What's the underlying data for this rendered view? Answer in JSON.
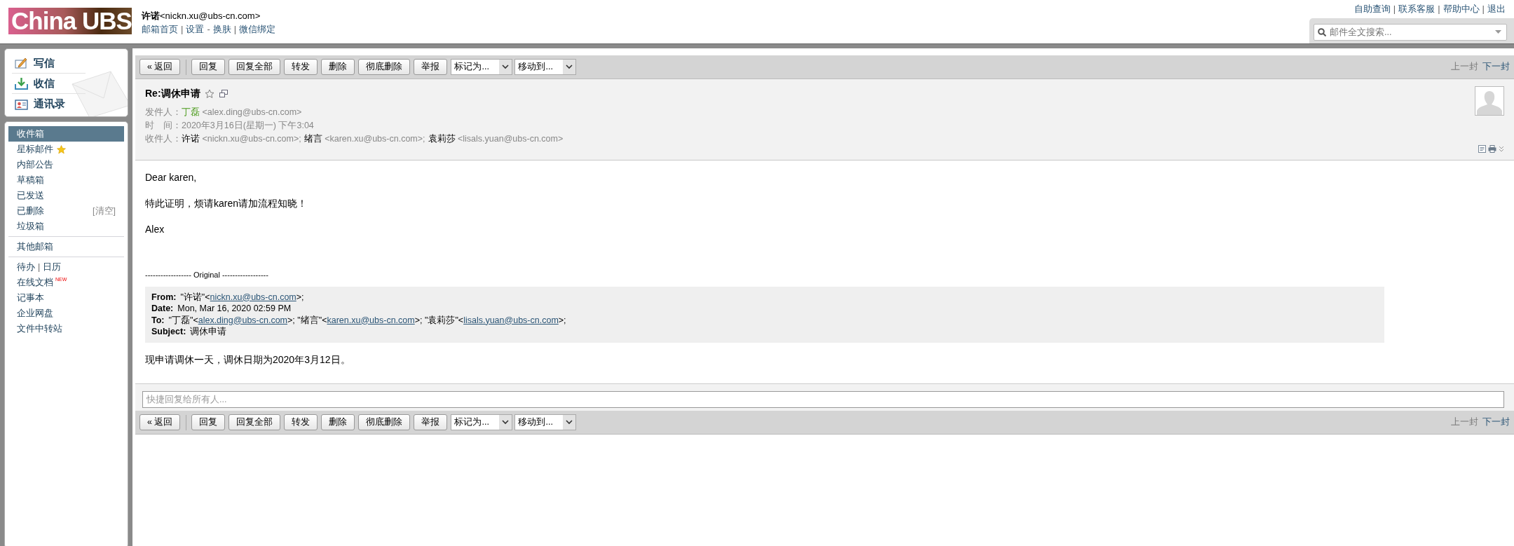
{
  "header": {
    "logo": "China UBS",
    "user_name": "许诺",
    "user_email": "<nickn.xu@ubs-cn.com>",
    "links": [
      {
        "kind": "link",
        "text": "邮箱首页"
      },
      {
        "kind": "sep",
        "text": "|"
      },
      {
        "kind": "link",
        "text": "设置"
      },
      {
        "kind": "sep",
        "text": "-"
      },
      {
        "kind": "link",
        "text": "换肤"
      },
      {
        "kind": "sep",
        "text": "|"
      },
      {
        "kind": "link",
        "text": "微信绑定"
      }
    ],
    "top_links": [
      {
        "kind": "link",
        "text": "自助查询"
      },
      {
        "kind": "sep",
        "text": "|"
      },
      {
        "kind": "link",
        "text": "联系客服"
      },
      {
        "kind": "sep",
        "text": "|"
      },
      {
        "kind": "link",
        "text": "帮助中心"
      },
      {
        "kind": "sep",
        "text": "|"
      },
      {
        "kind": "link",
        "text": "退出"
      }
    ],
    "search": {
      "placeholder": "邮件全文搜索..."
    }
  },
  "quick_actions": [
    {
      "kind": "compose",
      "label": "写信"
    },
    {
      "kind": "receive",
      "label": "收信"
    },
    {
      "kind": "contacts",
      "label": "通讯录"
    }
  ],
  "folder_groups": [
    [
      {
        "kind": "folder",
        "label": "收件箱",
        "selected": true
      },
      {
        "kind": "starred",
        "label": "星标邮件",
        "selected": false
      },
      {
        "kind": "folder",
        "label": "内部公告",
        "selected": false
      },
      {
        "kind": "folder",
        "label": "草稿箱",
        "selected": false
      },
      {
        "kind": "folder",
        "label": "已发送",
        "selected": false
      },
      {
        "kind": "folder",
        "label": "已删除",
        "selected": false,
        "action": "[清空]"
      },
      {
        "kind": "folder",
        "label": "垃圾箱",
        "selected": false
      }
    ],
    [
      {
        "kind": "folder",
        "label": "其他邮箱",
        "selected": false
      }
    ],
    [
      {
        "kind": "pair",
        "label": "待办",
        "separator": "|",
        "label2": "日历",
        "selected": false
      },
      {
        "kind": "folder",
        "label": "在线文档",
        "badge": "NEW",
        "selected": false
      },
      {
        "kind": "folder",
        "label": "记事本",
        "selected": false
      },
      {
        "kind": "folder",
        "label": "企业网盘",
        "selected": false
      },
      {
        "kind": "folder",
        "label": "文件中转站",
        "selected": false
      }
    ]
  ],
  "toolbars": [
    {
      "back": "« 返回",
      "buttons": [
        "回复",
        "回复全部",
        "转发",
        "删除",
        "彻底删除",
        "举报"
      ],
      "dropdowns": [
        "标记为...",
        "移动到..."
      ],
      "prev": {
        "text": "上一封",
        "disabled": true
      },
      "next": {
        "text": "下一封",
        "disabled": false
      }
    },
    {
      "back": "« 返回",
      "buttons": [
        "回复",
        "回复全部",
        "转发",
        "删除",
        "彻底删除",
        "举报"
      ],
      "dropdowns": [
        "标记为...",
        "移动到..."
      ],
      "prev": {
        "text": "上一封",
        "disabled": true
      },
      "next": {
        "text": "下一封",
        "disabled": false
      }
    }
  ],
  "mail": {
    "subject": "Re:调休申请",
    "starred": false,
    "from_label": "发件人：",
    "from_name": "丁磊",
    "from_email": "<alex.ding@ubs-cn.com>",
    "time_label": "时　间：",
    "time": "2020年3月16日(星期一) 下午3:04",
    "to_label": "收件人：",
    "recipients": [
      {
        "name": "许诺",
        "email": "<nickn.xu@ubs-cn.com>;"
      },
      {
        "name": "绪言",
        "email": "<karen.xu@ubs-cn.com>;"
      },
      {
        "name": "袁莉莎",
        "email": "<lisals.yuan@ubs-cn.com>"
      }
    ],
    "paragraphs": [
      "Dear karen,",
      "特此证明，烦请karen请加流程知晓！",
      "Alex"
    ],
    "original_divider": "------------------ Original ------------------",
    "quote": [
      {
        "label": "From:",
        "segments": [
          {
            "text": "\"许诺\"<",
            "link": false
          },
          {
            "text": "nickn.xu@ubs-cn.com",
            "link": true
          },
          {
            "text": ">;",
            "link": false
          }
        ]
      },
      {
        "label": "Date:",
        "segments": [
          {
            "text": "Mon, Mar 16, 2020 02:59 PM",
            "link": false
          }
        ]
      },
      {
        "label": "To:",
        "segments": [
          {
            "text": "\"丁磊\"<",
            "link": false
          },
          {
            "text": "alex.ding@ubs-cn.com",
            "link": true
          },
          {
            "text": ">; \"绪言\"<",
            "link": false
          },
          {
            "text": "karen.xu@ubs-cn.com",
            "link": true
          },
          {
            "text": ">; \"袁莉莎\"<",
            "link": false
          },
          {
            "text": "lisals.yuan@ubs-cn.com",
            "link": true
          },
          {
            "text": ">;",
            "link": false
          }
        ]
      },
      {
        "label": "Subject:",
        "segments": [
          {
            "text": "调休申请",
            "link": false
          }
        ]
      }
    ],
    "closing": "现申请调休一天，调休日期为2020年3月12日。"
  },
  "reply": {
    "placeholder": "快捷回复给所有人..."
  }
}
